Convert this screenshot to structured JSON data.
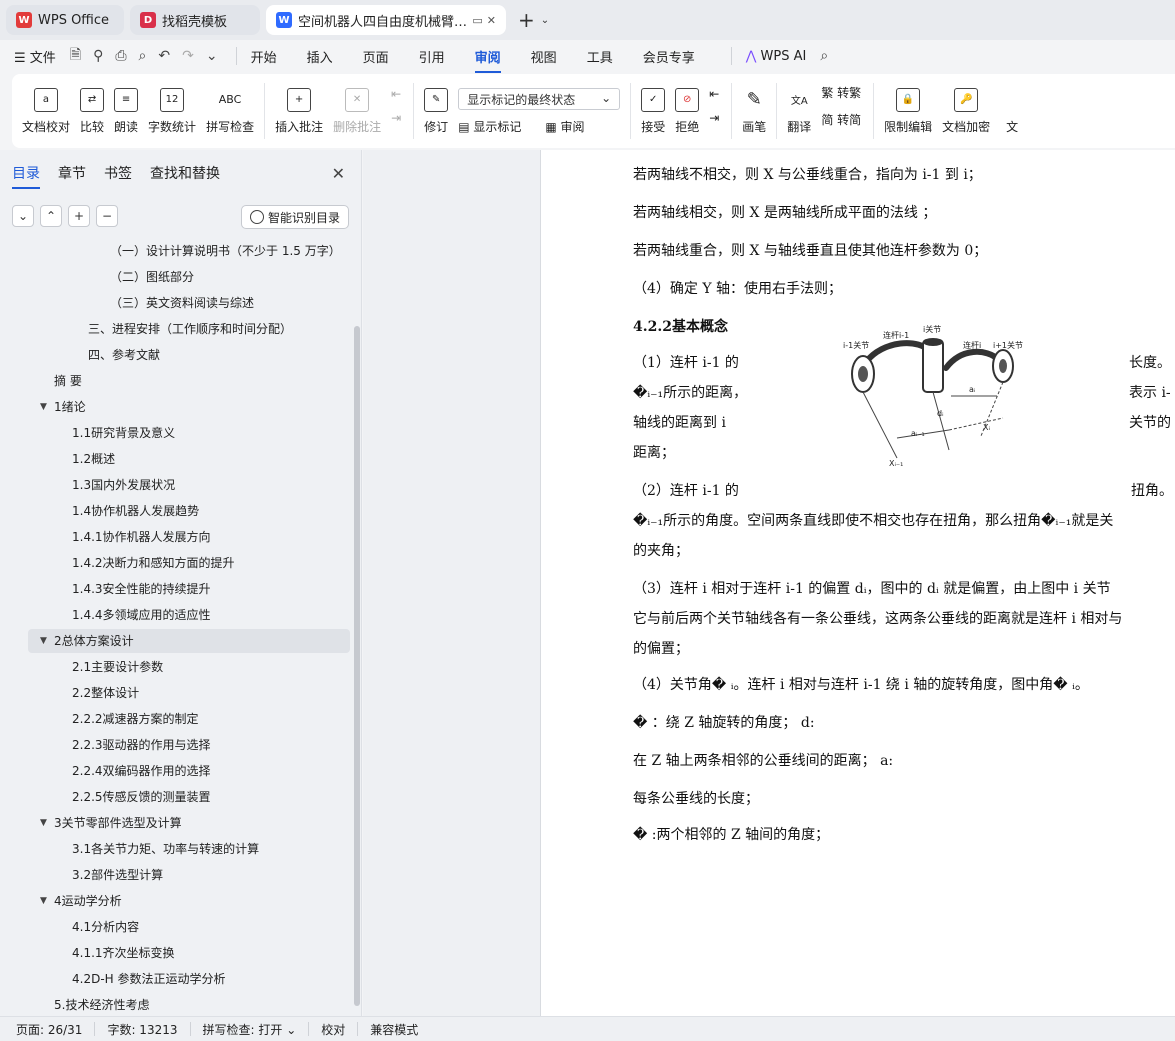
{
  "tabs": [
    {
      "label": "WPS Office"
    },
    {
      "label": "找稻壳模板"
    },
    {
      "label": "空间机器人四自由度机械臂的设计"
    }
  ],
  "menubar": {
    "file": "文件",
    "items": [
      "开始",
      "插入",
      "页面",
      "引用",
      "审阅",
      "视图",
      "工具",
      "会员专享"
    ],
    "active": "审阅",
    "wps_ai": "WPS AI"
  },
  "ribbon": {
    "doc_check": "文档校对",
    "compare": "比较",
    "read_aloud": "朗读",
    "word_count": "字数统计",
    "spell_check": "拼写检查",
    "insert_comment": "插入批注",
    "delete_comment": "删除批注",
    "revise": "修订",
    "display_select": "显示标记的最终状态",
    "show_markup": "显示标记",
    "review": "审阅",
    "accept": "接受",
    "reject": "拒绝",
    "pen": "画笔",
    "translate": "翻译",
    "to_traditional": "转繁",
    "to_simplified": "转简",
    "restrict_edit": "限制编辑",
    "doc_encrypt": "文档加密",
    "more": "文"
  },
  "sidebar": {
    "tabs": [
      "目录",
      "章节",
      "书签",
      "查找和替换"
    ],
    "smart_toc": "智能识别目录",
    "toc": [
      {
        "text": "（一）设计计算说明书（不少于 1.5 万字）",
        "level": 3
      },
      {
        "text": "（二）图纸部分",
        "level": 3
      },
      {
        "text": "（三）英文资料阅读与综述",
        "level": 3
      },
      {
        "text": "三、进程安排（工作顺序和时间分配）",
        "level": 2
      },
      {
        "text": "四、参考文献",
        "level": 2
      },
      {
        "text": "摘 要",
        "level": 1
      },
      {
        "text": "1绪论",
        "level": 1,
        "expander": true
      },
      {
        "text": "1.1研究背景及意义",
        "level": 2
      },
      {
        "text": "1.2概述",
        "level": 2
      },
      {
        "text": "1.3国内外发展状况",
        "level": 2
      },
      {
        "text": "1.4协作机器人发展趋势",
        "level": 2
      },
      {
        "text": "1.4.1协作机器人发展方向",
        "level": 2
      },
      {
        "text": "1.4.2决断力和感知方面的提升",
        "level": 2
      },
      {
        "text": "1.4.3安全性能的持续提升",
        "level": 2
      },
      {
        "text": "1.4.4多领域应用的适应性",
        "level": 2
      },
      {
        "text": "2总体方案设计",
        "level": 1,
        "expander": true,
        "selected": true
      },
      {
        "text": "2.1主要设计参数",
        "level": 2
      },
      {
        "text": "2.2整体设计",
        "level": 2
      },
      {
        "text": "2.2.2减速器方案的制定",
        "level": 2
      },
      {
        "text": "2.2.3驱动器的作用与选择",
        "level": 2
      },
      {
        "text": "2.2.4双编码器作用的选择",
        "level": 2
      },
      {
        "text": "2.2.5传感反馈的测量装置",
        "level": 2
      },
      {
        "text": "3关节零部件选型及计算",
        "level": 1,
        "expander": true
      },
      {
        "text": "3.1各关节力矩、功率与转速的计算",
        "level": 2
      },
      {
        "text": "3.2部件选型计算",
        "level": 2
      },
      {
        "text": "4运动学分析",
        "level": 1,
        "expander": true
      },
      {
        "text": "4.1分析内容",
        "level": 2
      },
      {
        "text": "4.1.1齐次坐标变换",
        "level": 2
      },
      {
        "text": "4.2D-H 参数法正运动学分析",
        "level": 2
      },
      {
        "text": "5.技术经济性考虑",
        "level": 1
      }
    ]
  },
  "document": {
    "lines": [
      "若两轴线不相交，则 X 与公垂线重合，指向为 i-1 到 i；",
      "若两轴线相交，则 X 是两轴线所成平面的法线 ；",
      "若两轴线重合，则 X 与轴线垂直且使其他连杆参数为 0；",
      "（4）确定 Y 轴：使用右手法则；",
      "4.2.2基本概念",
      "（1）连杆 i-1 的",
      "长度。",
      "�ᵢ₋₁所示的距离，",
      "表示 i-",
      "轴线的距离到 i",
      "关节的",
      "距离；",
      "（2）连杆 i-1 的",
      "扭角。",
      "�ᵢ₋₁所示的角度。空间两条直线即使不相交也存在扭角，那么扭角�ᵢ₋₁就是关",
      "的夹角；",
      "（3）连杆 i 相对于连杆 i-1 的偏置 dᵢ，图中的 dᵢ 就是偏置，由上图中 i 关节",
      "它与前后两个关节轴线各有一条公垂线，这两条公垂线的距离就是连杆 i 相对与",
      "的偏置；",
      "（4）关节角� ᵢ。连杆 i 相对与连杆 i-1 绕 i 轴的旋转角度，图中角� ᵢ。",
      "� ：绕       Z       轴旋转的角度； d:",
      "在 Z 轴上两条相邻的公垂线间的距离； a:",
      "每条公垂线的长度；",
      "� :两个相邻的 Z 轴间的角度；"
    ],
    "figure_labels": [
      "i-1关节",
      "连杆i-1",
      "i关节",
      "连杆i",
      "i+1关节",
      "aᵢ₋₁",
      "dᵢ",
      "aᵢ",
      "Xᵢ₋₁",
      "Xᵢ"
    ]
  },
  "statusbar": {
    "page": "页面: 26/31",
    "words": "字数: 13213",
    "spell": "拼写检查: 打开",
    "proof": "校对",
    "compat": "兼容模式"
  }
}
